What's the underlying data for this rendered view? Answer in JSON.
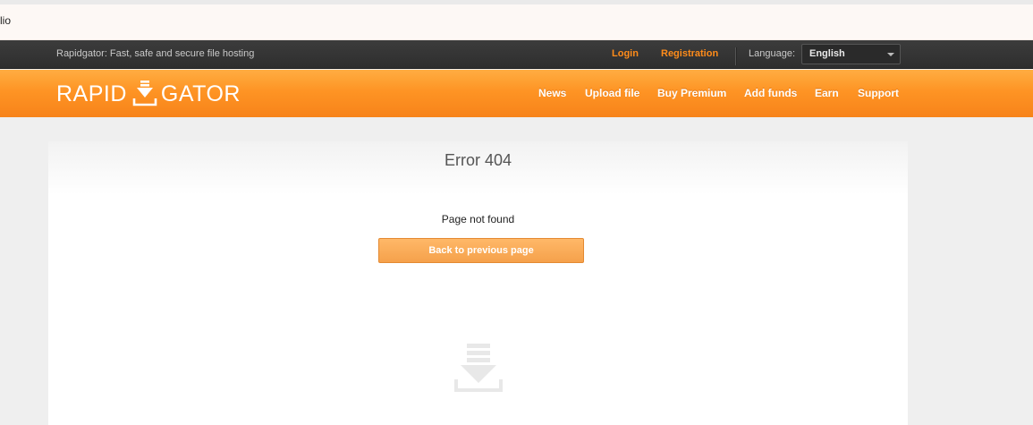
{
  "notice": {
    "text": "lio"
  },
  "topbar": {
    "tagline": "Rapidgator: Fast, safe and secure file hosting",
    "login": "Login",
    "registration": "Registration",
    "language_label": "Language:",
    "language_value": "English"
  },
  "header": {
    "logo_left": "RAPID",
    "logo_right": "GATOR",
    "nav": [
      "News",
      "Upload file",
      "Buy Premium",
      "Add funds",
      "Earn",
      "Support"
    ]
  },
  "main": {
    "title": "Error 404",
    "message": "Page not found",
    "back_button": "Back to previous page"
  },
  "colors": {
    "orange": "#fe9424",
    "dark_bar": "#333333",
    "link_orange": "#ff8c1a",
    "button": "#f5a14b"
  }
}
